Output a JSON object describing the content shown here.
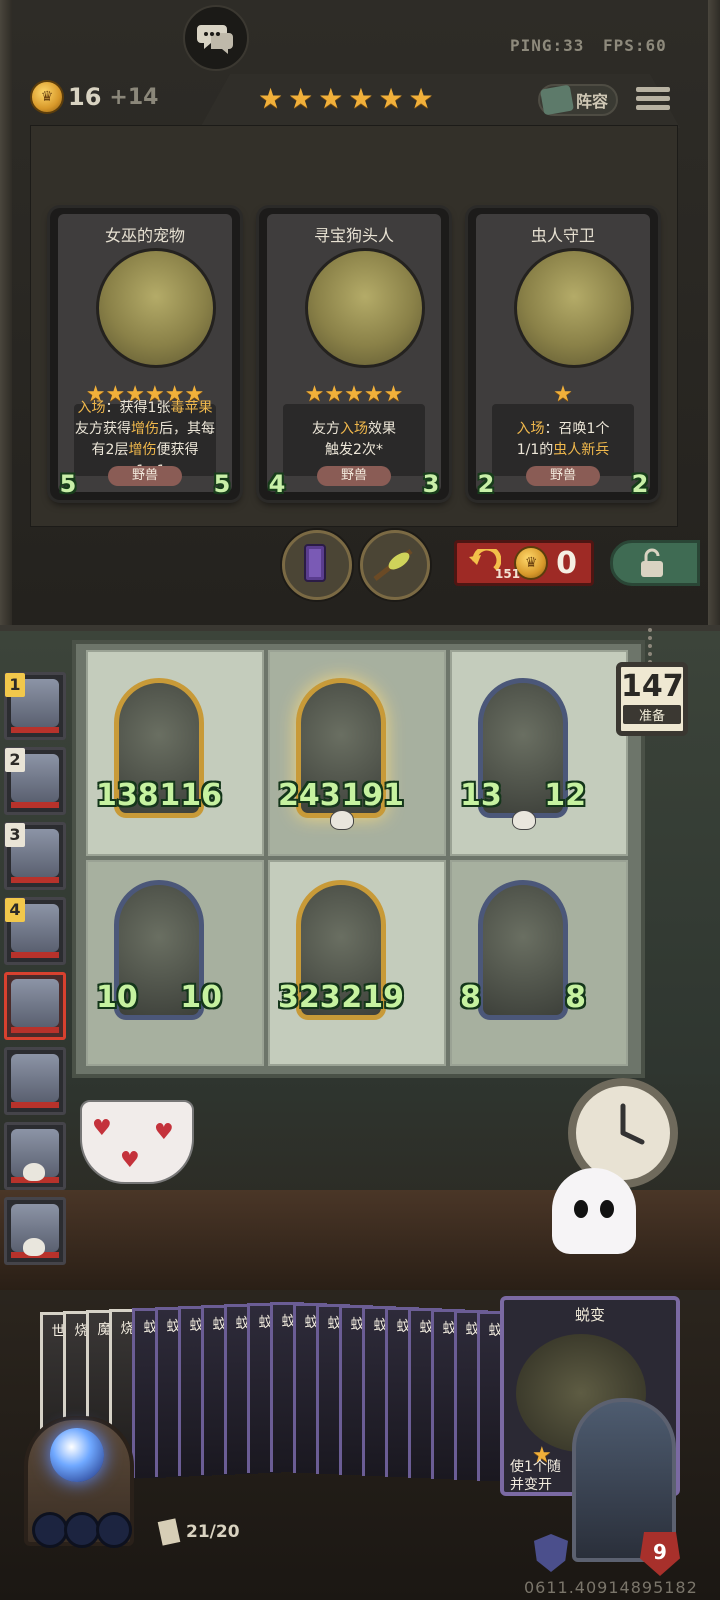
{
  "status": {
    "ping": "PING:33",
    "fps": "FPS:60"
  },
  "economy": {
    "gold": "16",
    "income": "+14",
    "tier_stars": 6
  },
  "top_bar": {
    "lineup_label": "阵容"
  },
  "shop": {
    "cards": [
      {
        "name": "女巫的宠物",
        "stars": 6,
        "text_lines": [
          [
            {
              "t": "入场",
              "kw": true
            },
            {
              "t": "：获得1张"
            },
            {
              "t": "毒苹果",
              "kw": true
            }
          ],
          [
            {
              "t": "友方获得"
            },
            {
              "t": "增伤",
              "kw": true
            },
            {
              "t": "后，其每"
            }
          ],
          [
            {
              "t": "有2层"
            },
            {
              "t": "增伤",
              "kw": true
            },
            {
              "t": "便获得+1+1"
            }
          ]
        ],
        "tribe": "野兽",
        "attack": "5",
        "health": "5"
      },
      {
        "name": "寻宝狗头人",
        "stars": 5,
        "text_lines": [
          [
            {
              "t": "友方"
            },
            {
              "t": "入场",
              "kw": true
            },
            {
              "t": "效果"
            }
          ],
          [
            {
              "t": "触发2次*"
            }
          ]
        ],
        "tribe": "野兽",
        "attack": "4",
        "health": "3"
      },
      {
        "name": "虫人守卫",
        "stars": 1,
        "text_lines": [
          [
            {
              "t": "入场",
              "kw": true
            },
            {
              "t": "：召唤1个"
            }
          ],
          [
            {
              "t": "1/1的"
            },
            {
              "t": "虫人新兵",
              "kw": true
            }
          ]
        ],
        "tribe": "野兽",
        "attack": "2",
        "health": "2"
      }
    ],
    "reroll": {
      "remaining": "151",
      "cost": "0"
    }
  },
  "battle": {
    "prep_timer": "147",
    "prep_label": "准备",
    "units": [
      {
        "attack": "138",
        "health": "116",
        "frame": "gold",
        "skull": false,
        "glow": false
      },
      {
        "attack": "243",
        "health": "191",
        "frame": "gold",
        "skull": true,
        "glow": true
      },
      {
        "attack": "13",
        "health": "12",
        "frame": "blue",
        "skull": true,
        "glow": false
      },
      {
        "attack": "10",
        "health": "10",
        "frame": "blue",
        "skull": false,
        "glow": false
      },
      {
        "attack": "323",
        "health": "219",
        "frame": "gold",
        "skull": false,
        "glow": false
      },
      {
        "attack": "8",
        "health": "8",
        "frame": "blue",
        "skull": false,
        "glow": false
      }
    ],
    "players": [
      {
        "rank": "1",
        "gold": true,
        "me": false,
        "dead": false
      },
      {
        "rank": "2",
        "gold": false,
        "me": false,
        "dead": false
      },
      {
        "rank": "3",
        "gold": false,
        "me": false,
        "dead": false
      },
      {
        "rank": "4",
        "gold": true,
        "me": false,
        "dead": false
      },
      {
        "rank": "",
        "gold": false,
        "me": true,
        "dead": false
      },
      {
        "rank": "",
        "gold": false,
        "me": false,
        "dead": false
      },
      {
        "rank": "",
        "gold": false,
        "me": false,
        "dead": true
      },
      {
        "rank": "",
        "gold": false,
        "me": false,
        "dead": true
      }
    ]
  },
  "hand": {
    "card_labels": [
      "世",
      "烧",
      "魔",
      "烧",
      "蚊",
      "蚊",
      "蚊",
      "蚊",
      "蚊",
      "蚊",
      "蚊",
      "蚊",
      "蚊",
      "蚊",
      "蚊",
      "蚊",
      "蚊",
      "蚊",
      "蚊",
      "蚊"
    ],
    "featured": {
      "name": "蜕变",
      "text": "使1个随\n并变开"
    },
    "deck_count": "21/20"
  },
  "hero": {
    "health": "9"
  },
  "watermark": "0611.40914895182",
  "colors": {
    "keyword": "#f0b84c",
    "star": "#f1b03a",
    "reroll": "#9e2a25",
    "lock": "#3f6b53"
  }
}
